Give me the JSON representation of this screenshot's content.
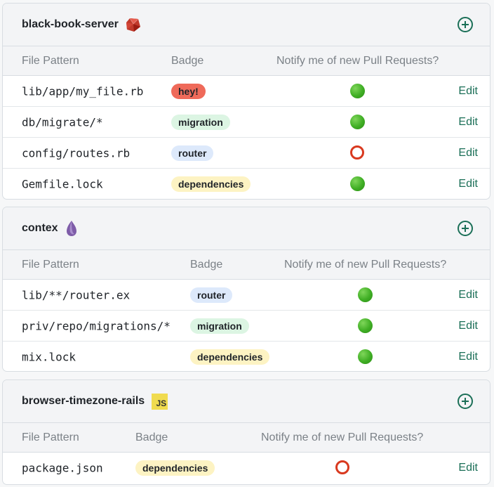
{
  "columns": {
    "pattern": "File Pattern",
    "badge": "Badge",
    "notify": "Notify me of new Pull Requests?"
  },
  "edit_label": "Edit",
  "repos": [
    {
      "name": "black-book-server",
      "icon": "ruby-icon",
      "rows": [
        {
          "pattern": "lib/app/my_file.rb",
          "badge": "hey!",
          "badge_color": "#ef6a5a",
          "notify": true
        },
        {
          "pattern": "db/migrate/*",
          "badge": "migration",
          "badge_color": "#dcf5e3",
          "notify": true
        },
        {
          "pattern": "config/routes.rb",
          "badge": "router",
          "badge_color": "#dde9fb",
          "notify": false
        },
        {
          "pattern": "Gemfile.lock",
          "badge": "dependencies",
          "badge_color": "#fdf3c3",
          "notify": true
        }
      ]
    },
    {
      "name": "contex",
      "icon": "elixir-icon",
      "rows": [
        {
          "pattern": "lib/**/router.ex",
          "badge": "router",
          "badge_color": "#dde9fb",
          "notify": true
        },
        {
          "pattern": "priv/repo/migrations/*",
          "badge": "migration",
          "badge_color": "#dcf5e3",
          "notify": true
        },
        {
          "pattern": "mix.lock",
          "badge": "dependencies",
          "badge_color": "#fdf3c3",
          "notify": true
        }
      ]
    },
    {
      "name": "browser-timezone-rails",
      "icon": "javascript-icon",
      "icon_text": "JS",
      "rows": [
        {
          "pattern": "package.json",
          "badge": "dependencies",
          "badge_color": "#fdf3c3",
          "notify": false
        }
      ]
    }
  ]
}
